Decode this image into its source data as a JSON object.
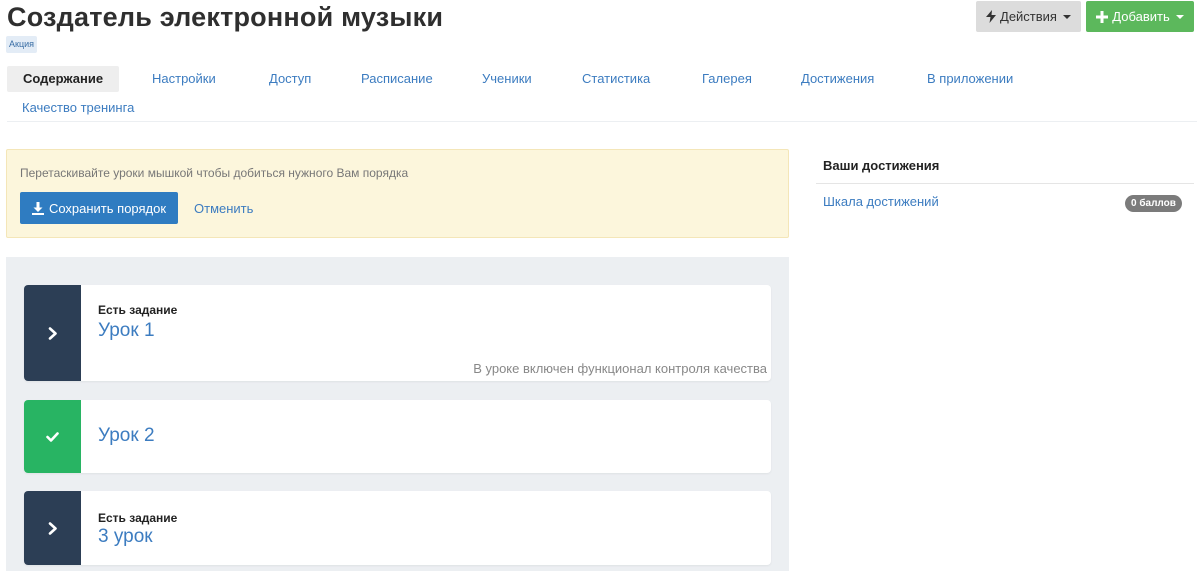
{
  "header": {
    "title": "Создатель электронной музыки",
    "tag": "Акция",
    "actions_label": "Действия",
    "add_label": "Добавить"
  },
  "tabs": [
    {
      "label": "Содержание",
      "active": true
    },
    {
      "label": "Настройки"
    },
    {
      "label": "Доступ"
    },
    {
      "label": "Расписание"
    },
    {
      "label": "Ученики"
    },
    {
      "label": "Статистика"
    },
    {
      "label": "Галерея"
    },
    {
      "label": "Достижения"
    },
    {
      "label": "В приложении"
    },
    {
      "label": "Качество тренинга"
    }
  ],
  "alert": {
    "text": "Перетаскивайте уроки мышкой чтобы добиться нужного Вам порядка",
    "save_label": "Сохранить порядок",
    "cancel_label": "Отменить"
  },
  "lessons": [
    {
      "tag": "Есть задание",
      "title": "Урок 1",
      "note": "В уроке включен функционал контроля качества",
      "status": "chevron"
    },
    {
      "tag": "",
      "title": "Урок 2",
      "note": "",
      "status": "check"
    },
    {
      "tag": "Есть задание",
      "title": "3 урок",
      "note": "",
      "status": "chevron"
    }
  ],
  "achievements": {
    "title": "Ваши достижения",
    "link_label": "Шкала достижений",
    "points_badge": "0 баллов"
  },
  "colors": {
    "accent": "#3c7cc0",
    "add_button": "#5cb85c",
    "lesson_dark": "#2c3e55",
    "lesson_done": "#28b463",
    "alert_bg": "#fcf6dc"
  }
}
